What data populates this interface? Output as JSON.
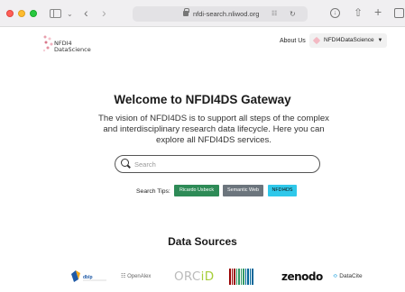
{
  "browser": {
    "url": "nfdi-search.nliwod.org"
  },
  "header": {
    "logo_line1": "NFDI4",
    "logo_line2": "DataScience",
    "nav_about": "About Us",
    "nav_brand": "NFDI4DataScience"
  },
  "hero": {
    "title": "Welcome to NFDI4DS Gateway",
    "description": "The vision of NFDI4DS is to support all steps of the complex and interdisciplinary research data lifecycle. Here you can explore all NFDI4DS services.",
    "search_placeholder": "Search",
    "search_value": ""
  },
  "search_tips": {
    "label": "Search Tips:",
    "items": [
      {
        "label": "Ricardo Usbeck",
        "color": "#2e8b57"
      },
      {
        "label": "Semantic Web",
        "color": "#6c757d"
      },
      {
        "label": "NFDI4DS",
        "color": "#2fc8ea"
      }
    ]
  },
  "data_sources": {
    "title": "Data Sources",
    "items": [
      {
        "name": "dblp",
        "icon": "dblp-logo"
      },
      {
        "name": "OpenAlex",
        "icon": "openalex-logo"
      },
      {
        "name_part1": "ORC",
        "name_part2": "iD",
        "icon": "orcid-logo"
      },
      {
        "name": "Wikidata",
        "icon": "wikidata-logo"
      },
      {
        "name": "zenodo",
        "icon": "zenodo-logo"
      },
      {
        "name_mark": "≎",
        "name": "DataCite",
        "icon": "datacite-logo"
      }
    ]
  }
}
